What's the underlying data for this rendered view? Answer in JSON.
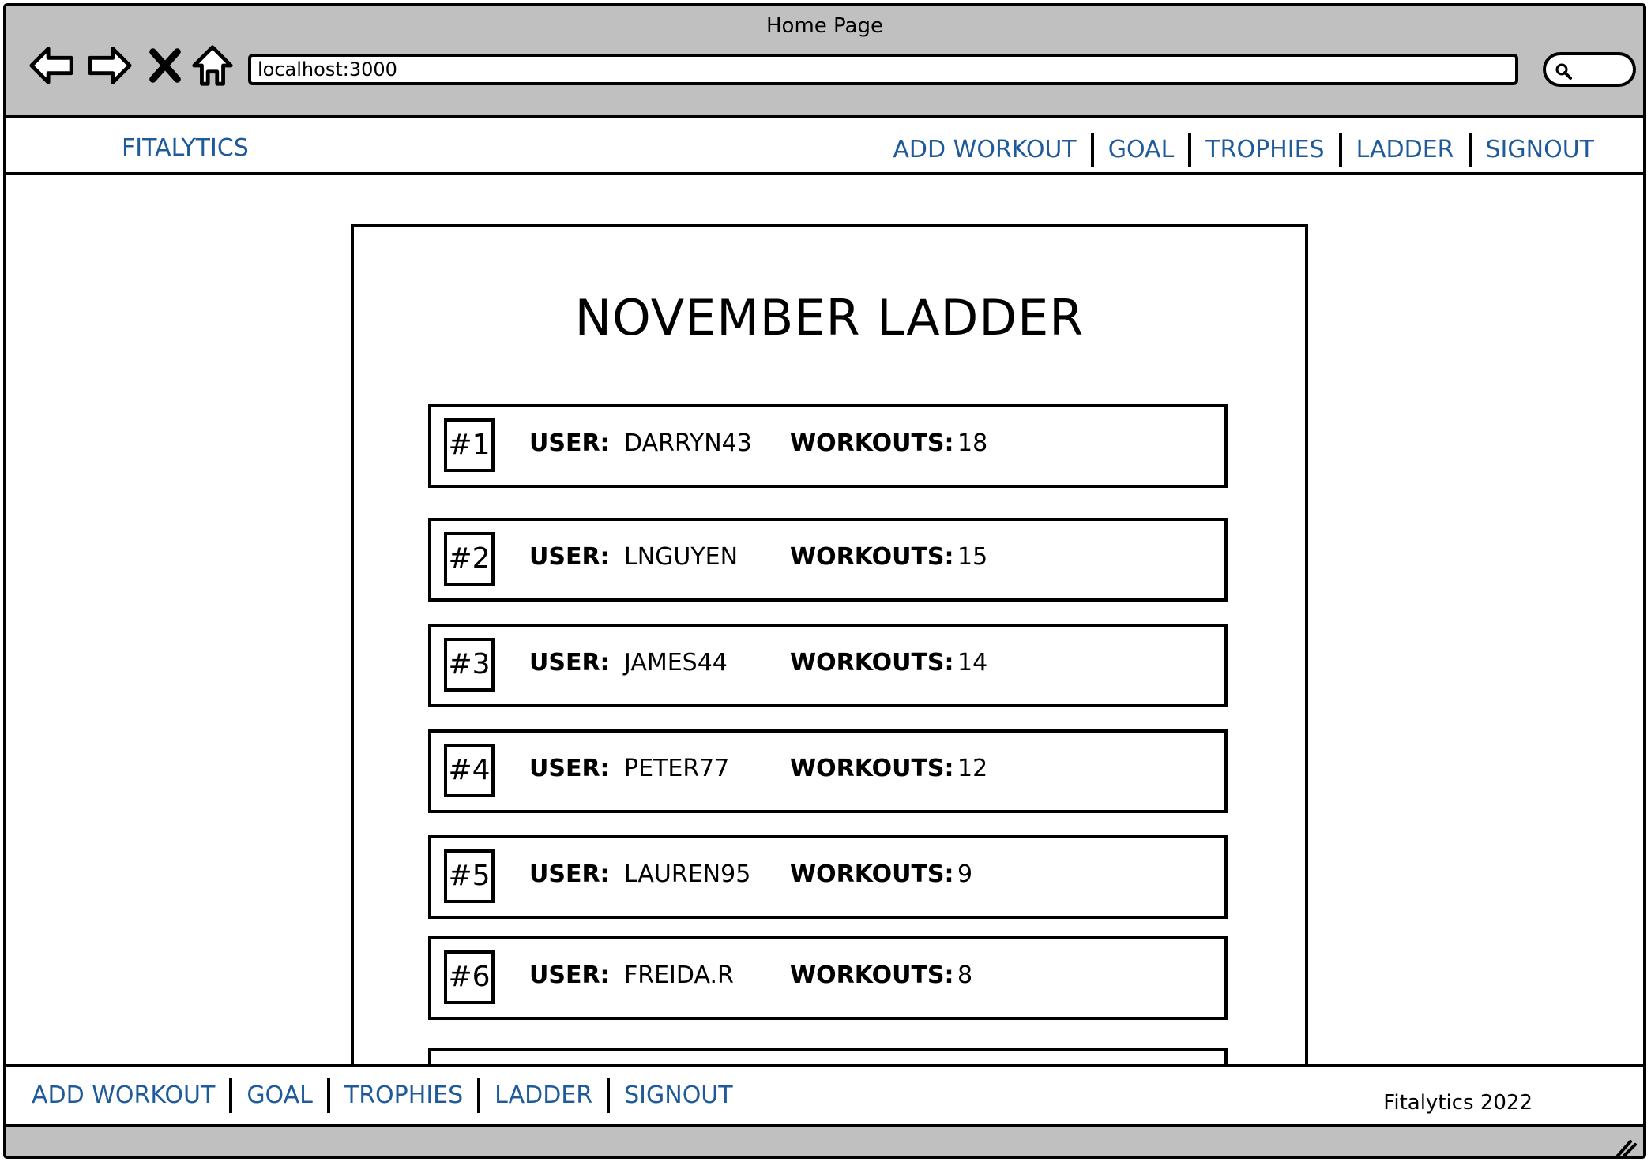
{
  "browser": {
    "title": "Home Page",
    "url": "localhost:3000"
  },
  "header": {
    "brand": "FITALYTICS",
    "nav": [
      "ADD WORKOUT",
      "GOAL",
      "TROPHIES",
      "LADDER",
      "SIGNOUT"
    ]
  },
  "ladder": {
    "title": "NOVEMBER LADDER",
    "user_label": "USER:",
    "workouts_label": "WORKOUTS:",
    "rows": [
      {
        "rank": "#1",
        "user": "DARRYN43",
        "workouts": "18"
      },
      {
        "rank": "#2",
        "user": "LNGUYEN",
        "workouts": "15"
      },
      {
        "rank": "#3",
        "user": "JAMES44",
        "workouts": "14"
      },
      {
        "rank": "#4",
        "user": "PETER77",
        "workouts": "12"
      },
      {
        "rank": "#5",
        "user": "LAUREN95",
        "workouts": "9"
      },
      {
        "rank": "#6",
        "user": "FREIDA.R",
        "workouts": "8"
      }
    ]
  },
  "footer": {
    "nav": [
      "ADD WORKOUT",
      "GOAL",
      "TROPHIES",
      "LADDER",
      "SIGNOUT"
    ],
    "copyright": "Fitalytics 2022"
  }
}
